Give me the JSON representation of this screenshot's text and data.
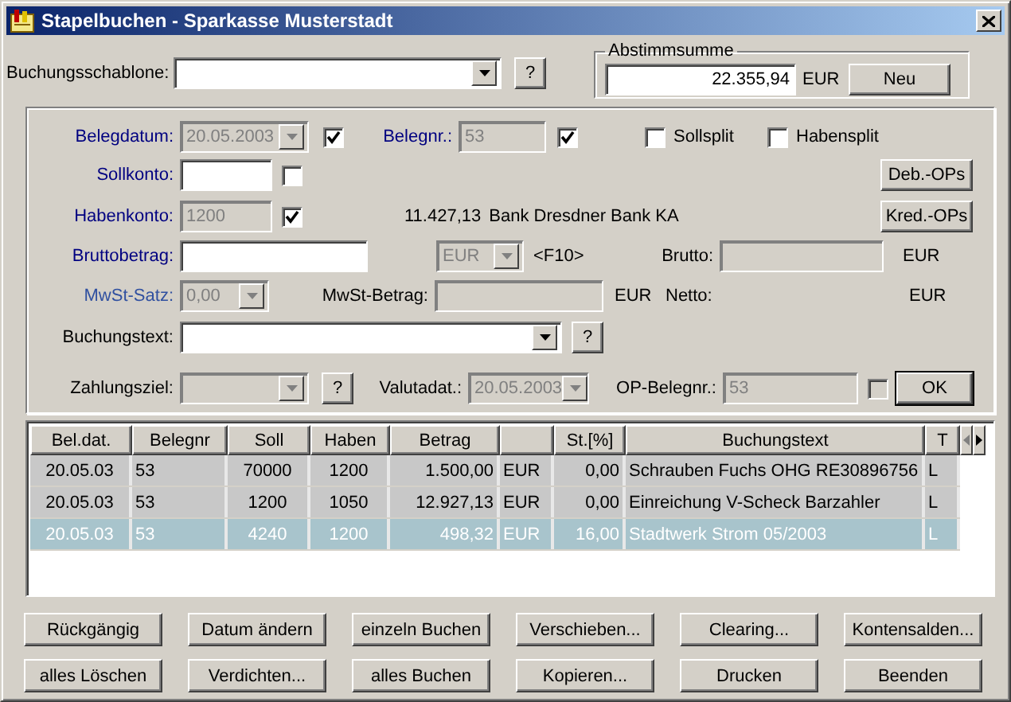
{
  "window": {
    "title": "Stapelbuchen - Sparkasse Musterstadt"
  },
  "template": {
    "label": "Buchungsschablone:",
    "help": "?"
  },
  "balance": {
    "legend": "Abstimmsumme",
    "value": "22.355,94",
    "currency": "EUR",
    "button": "Neu"
  },
  "belegdatum": {
    "label": "Belegdatum:",
    "required": true,
    "value": "20.05.2003",
    "disabled": true,
    "checked": true
  },
  "belegnr": {
    "label": "Belegnr.:",
    "required": true,
    "value": "53",
    "disabled": true,
    "checked": true
  },
  "splits": [
    {
      "label": "Sollsplit",
      "checked": false
    },
    {
      "label": "Habensplit",
      "checked": false
    }
  ],
  "sollkonto": {
    "label": "Sollkonto:",
    "required": true,
    "disabled": false,
    "checked": false,
    "button": "Deb.-OPs"
  },
  "habenkonto": {
    "label": "Habenkonto:",
    "required": true,
    "value": "1200",
    "disabled": true,
    "checked": true,
    "amount": "11.427,13",
    "account": "Bank Dresdner Bank KA",
    "button": "Kred.-OPs"
  },
  "bruttobetrag": {
    "label": "Bruttobetrag:",
    "required": true,
    "disabled": false,
    "currency": "EUR",
    "currency_disabled": true,
    "hint": "<F10>"
  },
  "brutto": {
    "label": "Brutto:",
    "disabled": true,
    "unit": "EUR"
  },
  "mwst_satz": {
    "label": "MwSt-Satz:",
    "required": true,
    "value": "0,00",
    "disabled": true
  },
  "mwst_betrag": {
    "label": "MwSt-Betrag:",
    "disabled": true,
    "unit": "EUR"
  },
  "netto": {
    "label": "Netto:",
    "unit": "EUR"
  },
  "buchungstext": {
    "label": "Buchungstext:",
    "required": false,
    "disabled": false,
    "help": "?"
  },
  "zahlungsziel": {
    "label": "Zahlungsziel:",
    "required": false,
    "disabled": true,
    "help": "?"
  },
  "valutadat": {
    "label": "Valutadat.:",
    "value": "20.05.2003",
    "disabled": true
  },
  "op_belegnr": {
    "label": "OP-Belegnr.:",
    "value": "53",
    "disabled": true,
    "checked": false
  },
  "ok_button": "OK",
  "table": {
    "columns": [
      {
        "label": "Bel.dat."
      },
      {
        "label": "Belegnr"
      },
      {
        "label": "Soll"
      },
      {
        "label": "Haben"
      },
      {
        "label": "Betrag"
      },
      {},
      {
        "label": "St.[%]"
      },
      {
        "label": "Buchungstext"
      },
      {
        "label": "T"
      }
    ],
    "rows": [
      {
        "cells": [
          "20.05.03",
          "53",
          "70000",
          "1200",
          "1.500,00",
          "EUR",
          "0,00",
          "Schrauben Fuchs OHG RE30896756",
          "L"
        ],
        "selected": false
      },
      {
        "cells": [
          "20.05.03",
          "53",
          "1200",
          "1050",
          "12.927,13",
          "EUR",
          "0,00",
          "Einreichung V-Scheck Barzahler",
          "L"
        ],
        "selected": false
      },
      {
        "cells": [
          "20.05.03",
          "53",
          "4240",
          "1200",
          "498,32",
          "EUR",
          "16,00",
          "Stadtwerk Strom 05/2003",
          "L"
        ],
        "selected": true
      }
    ]
  },
  "buttons": [
    [
      "Rückgängig",
      "Datum ändern",
      "einzeln Buchen",
      "Verschieben...",
      "Clearing...",
      "Kontensalden..."
    ],
    [
      "alles Löschen",
      "Verdichten...",
      "alles Buchen",
      "Kopieren...",
      "Drucken",
      "Beenden"
    ]
  ]
}
